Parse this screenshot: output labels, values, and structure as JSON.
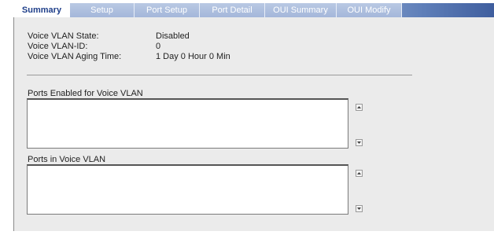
{
  "tabs": [
    "Summary",
    "Setup",
    "Port Setup",
    "Port Detail",
    "OUI Summary",
    "OUI Modify"
  ],
  "active_tab": "Summary",
  "summary": {
    "state_label": "Voice VLAN State:",
    "state_value": "Disabled",
    "vlan_id_label": "Voice VLAN-ID:",
    "vlan_id_value": "0",
    "aging_label": "Voice VLAN Aging Time:",
    "aging_value": "1 Day 0 Hour 0 Min"
  },
  "ports_enabled": {
    "label": "Ports Enabled for Voice VLAN"
  },
  "ports_in_vlan": {
    "label": "Ports in Voice VLAN"
  }
}
